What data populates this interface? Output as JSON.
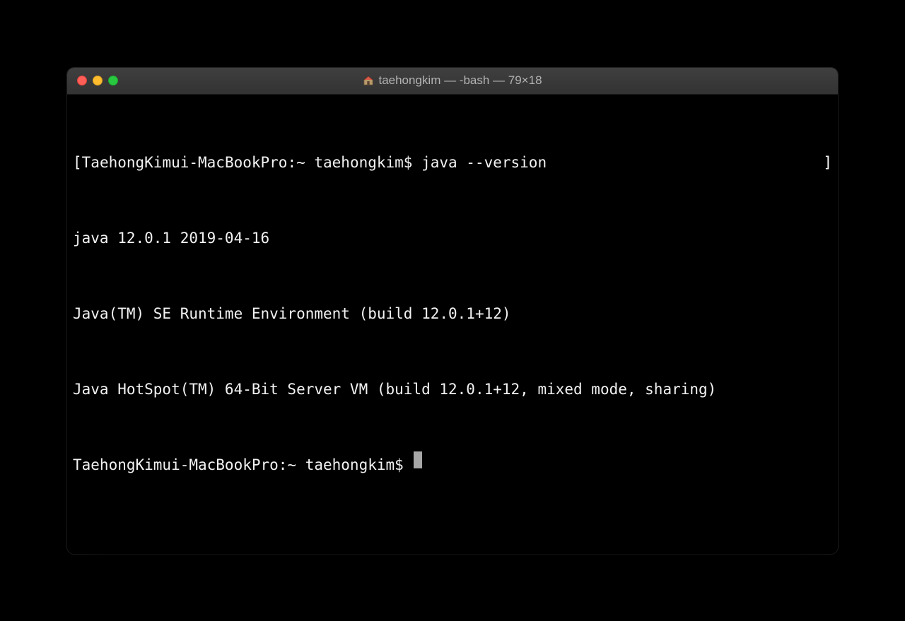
{
  "window": {
    "title": "taehongkim — -bash — 79×18"
  },
  "terminal": {
    "lines": [
      {
        "left_bracket": "[",
        "prompt": "TaehongKimui-MacBookPro:~ taehongkim$ ",
        "command": "java --version",
        "right_bracket": "]"
      },
      {
        "text": "java 12.0.1 2019-04-16"
      },
      {
        "text": "Java(TM) SE Runtime Environment (build 12.0.1+12)"
      },
      {
        "text": "Java HotSpot(TM) 64-Bit Server VM (build 12.0.1+12, mixed mode, sharing)"
      },
      {
        "prompt": "TaehongKimui-MacBookPro:~ taehongkim$ ",
        "cursor": true
      }
    ]
  }
}
